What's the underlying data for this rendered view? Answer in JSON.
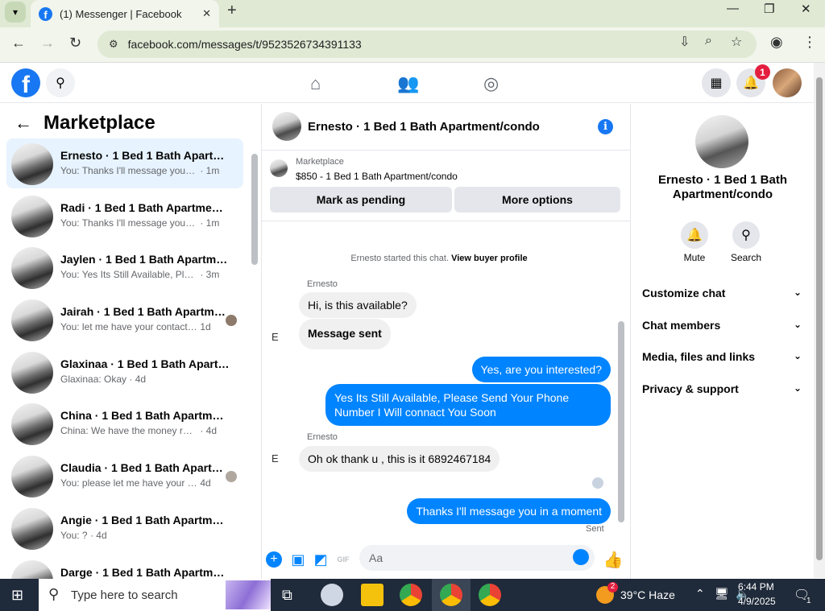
{
  "browser": {
    "tab_title": "(1) Messenger | Facebook",
    "url": "facebook.com/messages/t/9523526734391133"
  },
  "header": {
    "notification_count": "1"
  },
  "left_panel": {
    "title": "Marketplace",
    "conversations": [
      {
        "name": "Ernesto · 1 Bed 1 Bath Apartment/condo",
        "preview": "You: Thanks I'll message you in a moment",
        "time": "· 1m",
        "active": true
      },
      {
        "name": "Radi · 1 Bed 1 Bath Apartment/condo",
        "preview": "You: Thanks I'll message you in a moment",
        "time": "· 1m"
      },
      {
        "name": "Jaylen · 1 Bed 1 Bath Apartment/condo",
        "preview": "You: Yes Its Still Available, Please Send",
        "time": "· 3m"
      },
      {
        "name": "Jairah · 1 Bed 1 Bath Apartment/condo",
        "preview": "You: let me have your contact number",
        "time": "1d"
      },
      {
        "name": "Glaxinaa · 1 Bed 1 Bath Apartment/condo",
        "preview": "Glaxinaa: Okay",
        "time": "· 4d"
      },
      {
        "name": "China · 1 Bed 1 Bath Apartment/condo",
        "preview": "China: We have the money ready!",
        "time": "· 4d"
      },
      {
        "name": "Claudia · 1 Bed 1 Bath Apartment/condo",
        "preview": "You: please let me have your contact",
        "time": "4d"
      },
      {
        "name": "Angie · 1 Bed 1 Bath Apartment/condo",
        "preview": "You: ?",
        "time": "· 4d"
      },
      {
        "name": "Darge · 1 Bed 1 Bath Apartment/condo",
        "preview": "",
        "time": ""
      }
    ]
  },
  "chat": {
    "title": "Ernesto · 1 Bed 1 Bath Apartment/condo",
    "listing_label": "Marketplace",
    "listing_price": "$850 - 1 Bed 1 Bath Apartment/condo",
    "mark_pending": "Mark as pending",
    "more_options": "More options",
    "system_text": "Ernesto started this chat.",
    "system_link": "View buyer profile",
    "sender_name": "Ernesto",
    "msg1": "Hi, is this available?",
    "msg2": "Message sent",
    "msg3": "Yes, are you interested?",
    "msg4": "Yes Its Still Available, Please Send Your Phone Number I Will connact You Soon",
    "sender_name2": "Ernesto",
    "msg5": "Oh ok thank u , this is it 6892467184",
    "msg6": "Thanks I'll message you in a moment",
    "sent_status": "Sent",
    "broken_avatar_alt": "E",
    "composer_placeholder": "Aa"
  },
  "right_panel": {
    "name": "Ernesto · 1 Bed 1 Bath Apartment/condo",
    "mute_label": "Mute",
    "search_label": "Search",
    "sections": [
      "Customize chat",
      "Chat members",
      "Media, files and links",
      "Privacy & support"
    ]
  },
  "taskbar": {
    "search_placeholder": "Type here to search",
    "weather": "39°C  Haze",
    "weather_badge": "2",
    "time": "6:44 PM",
    "date": "4/9/2025",
    "notif_count": "1"
  },
  "colors": {
    "facebook_blue": "#1877f2",
    "messenger_blue": "#0084ff",
    "active_row": "#e7f3ff"
  }
}
